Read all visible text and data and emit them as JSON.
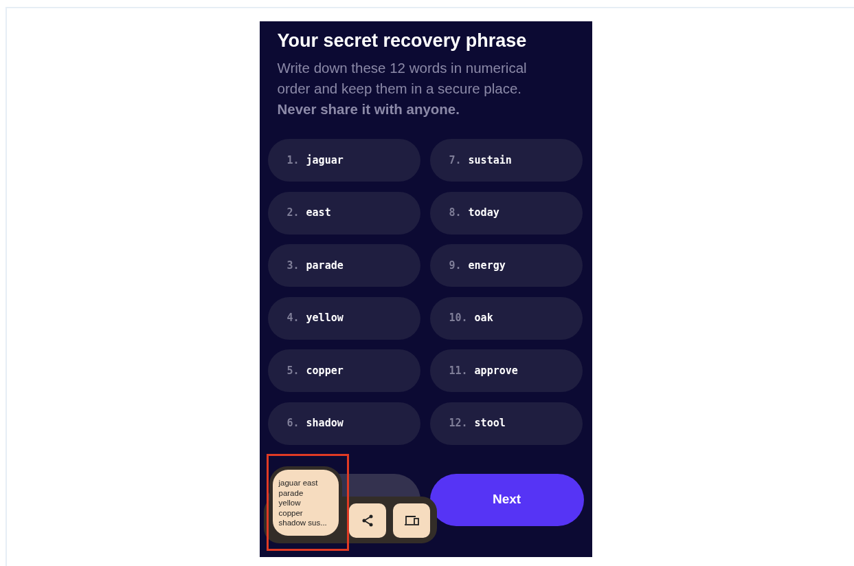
{
  "title": "Your secret recovery phrase",
  "description": "Write down these 12 words in numerical order and keep them in a secure place. **Never share it with anyone.**",
  "words": [
    {
      "number": "1.",
      "word": "jaguar"
    },
    {
      "number": "2.",
      "word": "east"
    },
    {
      "number": "3.",
      "word": "parade"
    },
    {
      "number": "4.",
      "word": "yellow"
    },
    {
      "number": "5.",
      "word": "copper"
    },
    {
      "number": "6.",
      "word": "shadow"
    },
    {
      "number": "7.",
      "word": "sustain"
    },
    {
      "number": "8.",
      "word": "today"
    },
    {
      "number": "9.",
      "word": "energy"
    },
    {
      "number": "10.",
      "word": "oak"
    },
    {
      "number": "11.",
      "word": "approve"
    },
    {
      "number": "12.",
      "word": "stool"
    }
  ],
  "next_button": "Next",
  "clipboard_preview": {
    "text": "jaguar east\nparade\nyellow\ncopper\nshadow sus...",
    "highlighted": true
  }
}
